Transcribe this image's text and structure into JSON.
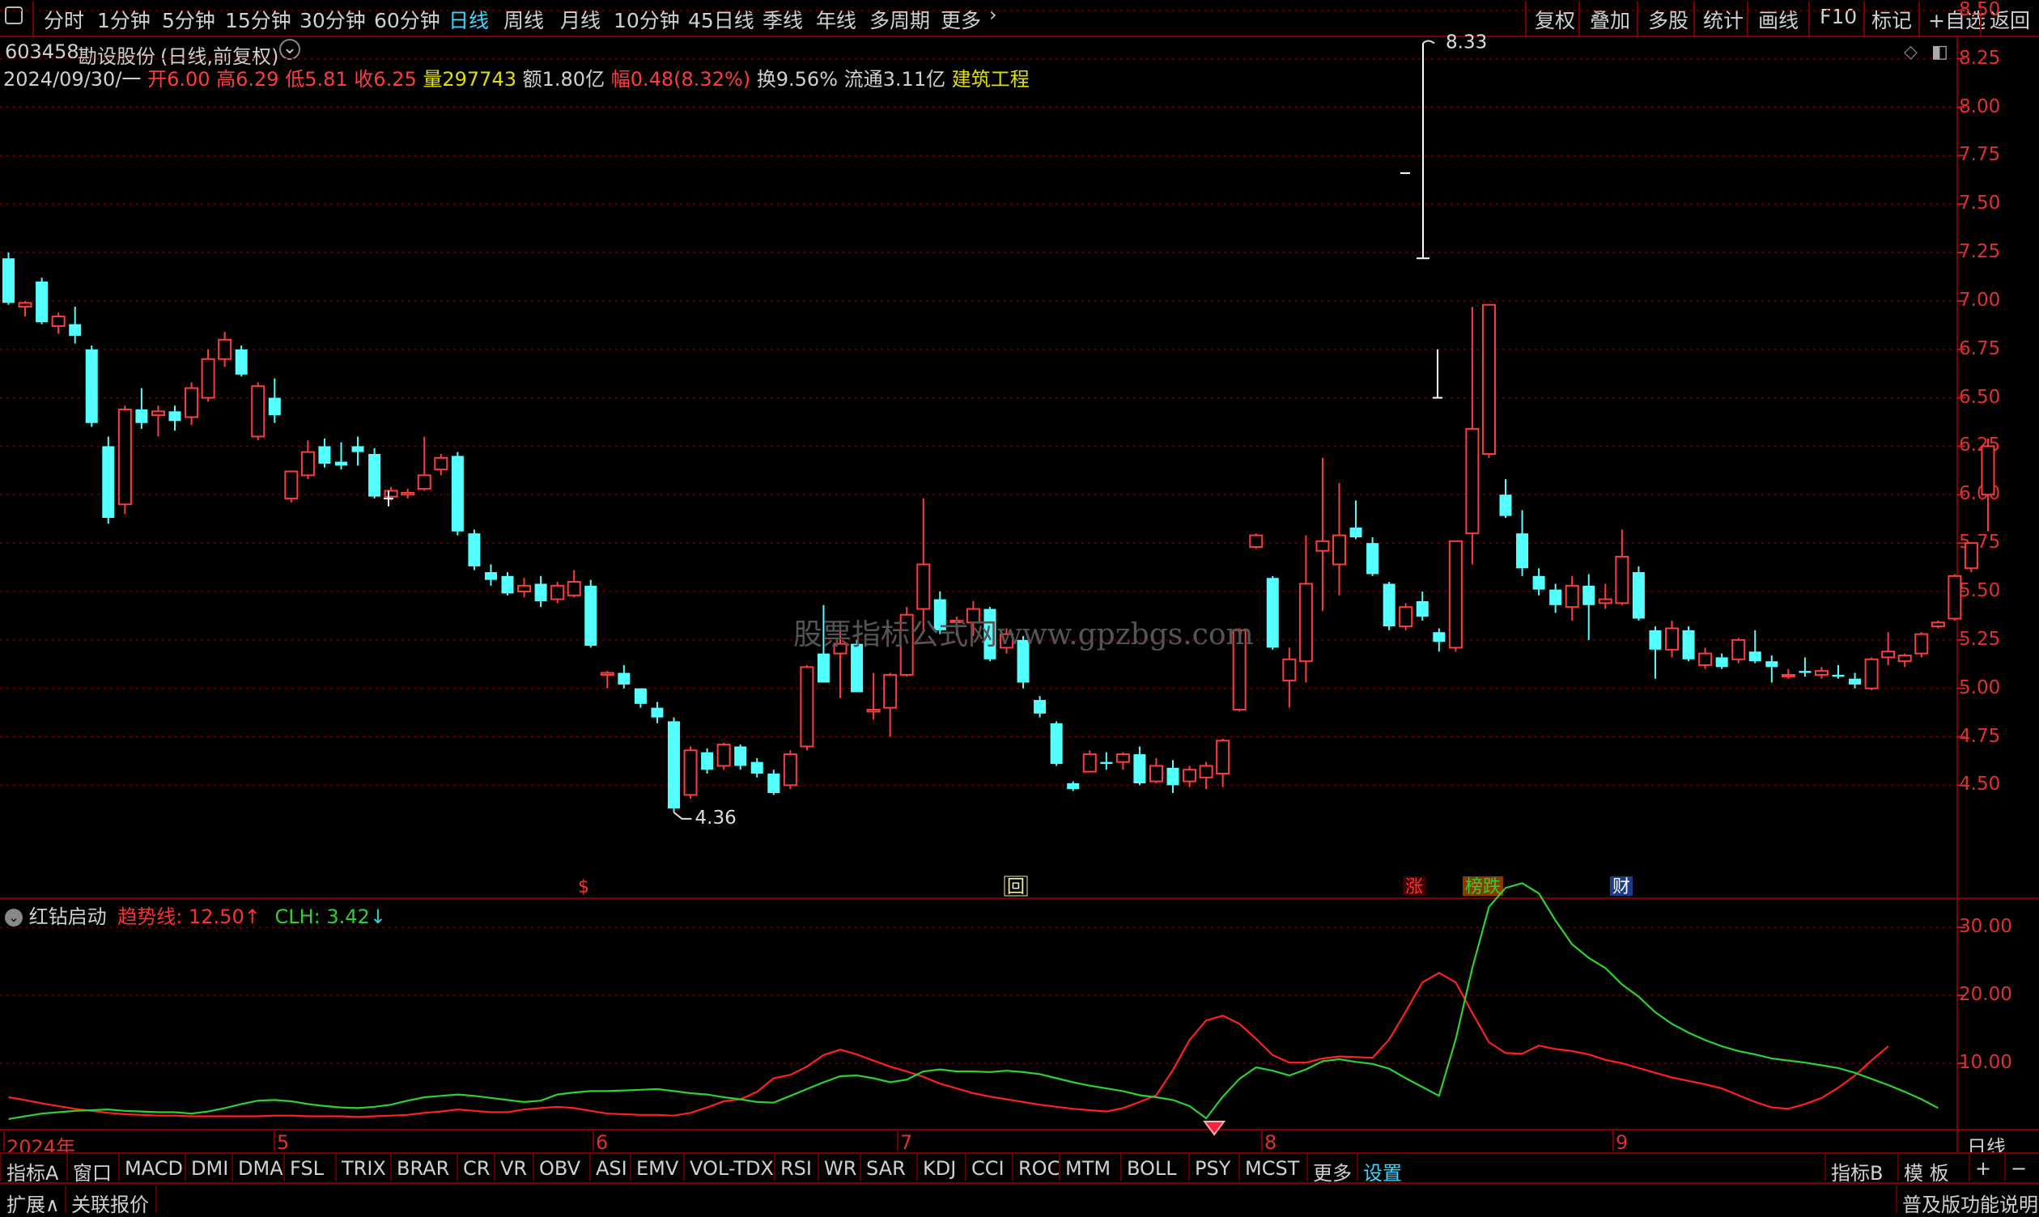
{
  "toolbar": {
    "periods": [
      "分时",
      "1分钟",
      "5分钟",
      "15分钟",
      "30分钟",
      "60分钟",
      "日线",
      "周线",
      "月线",
      "10分钟",
      "45日线",
      "季线",
      "年线",
      "多周期",
      "更多"
    ],
    "active": "日线",
    "right": [
      "复权",
      "叠加",
      "多股",
      "统计",
      "画线",
      "F10",
      "标记",
      "+自选",
      "返回"
    ]
  },
  "stock": {
    "code": "603458",
    "name": "勘设股份",
    "mode": "(日线,前复权)",
    "date": "2024/09/30/一",
    "open_label": "开",
    "open": "6.00",
    "high_label": "高",
    "high": "6.29",
    "low_label": "低",
    "low": "5.81",
    "close_label": "收",
    "close": "6.25",
    "vol_label": "量",
    "vol": "297743",
    "amt_label": "额",
    "amt": "1.80亿",
    "chg_label": "幅",
    "chg": "0.48(8.32%)",
    "turn_label": "换",
    "turn": "9.56%",
    "float_label": "流通",
    "float": "3.11亿",
    "sector": "建筑工程"
  },
  "watermark": "股票指标公式网www.gpzbgs.com",
  "price_axis": [
    "8.50",
    "8.25",
    "8.00",
    "7.75",
    "7.50",
    "7.25",
    "7.00",
    "6.75",
    "6.50",
    "6.25",
    "6.00",
    "5.75",
    "5.50",
    "5.25",
    "5.00",
    "4.75",
    "4.50"
  ],
  "annotations": {
    "high": "8.33",
    "low": "4.36"
  },
  "event_markers": [
    "$",
    "回",
    "涨",
    "榜跌",
    "财"
  ],
  "indicator": {
    "name": "红钻启动",
    "line1_label": "趋势线:",
    "line1_value": "12.50",
    "line2_label": "CLH:",
    "line2_value": "3.42",
    "axis": [
      "30.00",
      "20.00",
      "10.00"
    ]
  },
  "time_axis": {
    "labels": [
      "2024年",
      "5",
      "6",
      "7",
      "8",
      "9"
    ],
    "period": "日线"
  },
  "indicator_tabs": [
    "指标A",
    "窗口",
    "MACD",
    "DMI",
    "DMA",
    "FSL",
    "TRIX",
    "BRAR",
    "CR",
    "VR",
    "OBV",
    "ASI",
    "EMV",
    "VOL-TDX",
    "RSI",
    "WR",
    "SAR",
    "KDJ",
    "CCI",
    "ROC",
    "MTM",
    "BOLL",
    "PSY",
    "MCST",
    "更多",
    "设置"
  ],
  "indicator_right": [
    "指标B",
    "模 板",
    "+",
    "−"
  ],
  "footer": {
    "expand": "扩展∧",
    "quotes": "关联报价",
    "right": "普及版功能说明"
  },
  "colors": {
    "up": "#ff3c3c",
    "down": "#54ffff",
    "trend": "#ff2020",
    "clh": "#30d030",
    "grid": "#7a0000",
    "active": "#3ad6ff"
  },
  "chart_data": {
    "type": "candlestick",
    "ohlc": [
      [
        7.22,
        7.25,
        6.98,
        6.99
      ],
      [
        6.97,
        7.0,
        6.92,
        6.99
      ],
      [
        7.1,
        7.12,
        6.88,
        6.89
      ],
      [
        6.87,
        6.94,
        6.83,
        6.92
      ],
      [
        6.88,
        6.97,
        6.78,
        6.82
      ],
      [
        6.75,
        6.77,
        6.35,
        6.37
      ],
      [
        6.25,
        6.3,
        5.85,
        5.88
      ],
      [
        5.95,
        6.46,
        5.9,
        6.44
      ],
      [
        6.44,
        6.55,
        6.34,
        6.37
      ],
      [
        6.41,
        6.46,
        6.3,
        6.43
      ],
      [
        6.43,
        6.46,
        6.33,
        6.38
      ],
      [
        6.4,
        6.58,
        6.36,
        6.55
      ],
      [
        6.5,
        6.75,
        6.48,
        6.7
      ],
      [
        6.7,
        6.84,
        6.66,
        6.8
      ],
      [
        6.75,
        6.77,
        6.61,
        6.62
      ],
      [
        6.3,
        6.58,
        6.28,
        6.56
      ],
      [
        6.5,
        6.6,
        6.37,
        6.41
      ],
      [
        5.98,
        6.12,
        5.96,
        6.12
      ],
      [
        6.1,
        6.28,
        6.08,
        6.22
      ],
      [
        6.25,
        6.29,
        6.14,
        6.16
      ],
      [
        6.17,
        6.27,
        6.13,
        6.15
      ],
      [
        6.25,
        6.3,
        6.15,
        6.22
      ],
      [
        6.21,
        6.24,
        5.98,
        5.99
      ],
      [
        5.99,
        6.04,
        5.97,
        6.02
      ],
      [
        6.0,
        6.03,
        5.98,
        6.01
      ],
      [
        6.03,
        6.3,
        6.02,
        6.1
      ],
      [
        6.13,
        6.21,
        6.1,
        6.19
      ],
      [
        6.2,
        6.22,
        5.79,
        5.81
      ],
      [
        5.8,
        5.82,
        5.61,
        5.63
      ],
      [
        5.6,
        5.64,
        5.53,
        5.56
      ],
      [
        5.58,
        5.6,
        5.48,
        5.49
      ],
      [
        5.5,
        5.57,
        5.47,
        5.53
      ],
      [
        5.54,
        5.58,
        5.42,
        5.45
      ],
      [
        5.46,
        5.55,
        5.44,
        5.53
      ],
      [
        5.48,
        5.61,
        5.47,
        5.55
      ],
      [
        5.53,
        5.56,
        5.21,
        5.22
      ],
      [
        5.07,
        5.09,
        5.0,
        5.08
      ],
      [
        5.08,
        5.12,
        5.0,
        5.02
      ],
      [
        5.0,
        5.0,
        4.9,
        4.92
      ],
      [
        4.9,
        4.93,
        4.82,
        4.85
      ],
      [
        4.83,
        4.85,
        4.36,
        4.38
      ],
      [
        4.45,
        4.7,
        4.43,
        4.68
      ],
      [
        4.67,
        4.69,
        4.56,
        4.58
      ],
      [
        4.6,
        4.72,
        4.58,
        4.71
      ],
      [
        4.7,
        4.71,
        4.58,
        4.6
      ],
      [
        4.62,
        4.64,
        4.54,
        4.56
      ],
      [
        4.56,
        4.58,
        4.45,
        4.46
      ],
      [
        4.5,
        4.68,
        4.48,
        4.66
      ],
      [
        4.7,
        5.12,
        4.68,
        5.11
      ],
      [
        5.18,
        5.43,
        5.03,
        5.03
      ],
      [
        5.18,
        5.35,
        4.95,
        5.23
      ],
      [
        5.23,
        5.25,
        4.98,
        4.98
      ],
      [
        4.88,
        5.08,
        4.84,
        4.89
      ],
      [
        4.9,
        5.08,
        4.75,
        5.07
      ],
      [
        5.07,
        5.42,
        5.06,
        5.38
      ],
      [
        5.41,
        5.98,
        5.3,
        5.64
      ],
      [
        5.46,
        5.5,
        5.28,
        5.3
      ],
      [
        5.35,
        5.37,
        5.27,
        5.35
      ],
      [
        5.34,
        5.45,
        5.27,
        5.41
      ],
      [
        5.41,
        5.42,
        5.14,
        5.15
      ],
      [
        5.21,
        5.31,
        5.18,
        5.28
      ],
      [
        5.25,
        5.27,
        5.0,
        5.03
      ],
      [
        4.94,
        4.96,
        4.85,
        4.87
      ],
      [
        4.82,
        4.83,
        4.6,
        4.61
      ],
      [
        4.51,
        4.52,
        4.47,
        4.48
      ],
      [
        4.57,
        4.68,
        4.57,
        4.66
      ],
      [
        4.62,
        4.67,
        4.58,
        4.61
      ],
      [
        4.62,
        4.67,
        4.58,
        4.66
      ],
      [
        4.66,
        4.7,
        4.5,
        4.51
      ],
      [
        4.52,
        4.64,
        4.51,
        4.6
      ],
      [
        4.59,
        4.63,
        4.46,
        4.5
      ],
      [
        4.52,
        4.6,
        4.49,
        4.58
      ],
      [
        4.54,
        4.62,
        4.48,
        4.6
      ],
      [
        4.56,
        4.74,
        4.49,
        4.73
      ],
      [
        4.89,
        5.31,
        4.88,
        5.3
      ],
      [
        5.73,
        5.8,
        5.72,
        5.79
      ],
      [
        5.57,
        5.58,
        5.2,
        5.21
      ],
      [
        5.04,
        5.21,
        4.9,
        5.15
      ],
      [
        5.14,
        5.79,
        5.03,
        5.54
      ],
      [
        5.71,
        6.19,
        5.4,
        5.76
      ],
      [
        5.64,
        6.06,
        5.48,
        5.79
      ],
      [
        5.83,
        5.97,
        5.77,
        5.78
      ],
      [
        5.75,
        5.78,
        5.58,
        5.59
      ],
      [
        5.54,
        5.55,
        5.3,
        5.32
      ],
      [
        5.32,
        5.44,
        5.3,
        5.42
      ],
      [
        5.45,
        5.5,
        5.35,
        5.37
      ],
      [
        5.29,
        5.31,
        5.19,
        5.24
      ],
      [
        5.21,
        5.76,
        5.19,
        5.76
      ],
      [
        5.8,
        6.97,
        5.64,
        6.34
      ],
      [
        6.21,
        6.98,
        6.19,
        6.98
      ],
      [
        6.0,
        6.08,
        5.88,
        5.89
      ],
      [
        5.8,
        5.92,
        5.58,
        5.62
      ],
      [
        5.58,
        5.62,
        5.48,
        5.51
      ],
      [
        5.51,
        5.54,
        5.39,
        5.43
      ],
      [
        5.42,
        5.58,
        5.35,
        5.53
      ],
      [
        5.53,
        5.59,
        5.25,
        5.43
      ],
      [
        5.44,
        5.54,
        5.41,
        5.46
      ],
      [
        5.44,
        5.82,
        5.43,
        5.68
      ],
      [
        5.6,
        5.63,
        5.35,
        5.36
      ],
      [
        5.3,
        5.32,
        5.05,
        5.2
      ],
      [
        5.2,
        5.35,
        5.16,
        5.31
      ],
      [
        5.3,
        5.32,
        5.14,
        5.15
      ],
      [
        5.12,
        5.21,
        5.1,
        5.18
      ],
      [
        5.16,
        5.18,
        5.1,
        5.11
      ],
      [
        5.15,
        5.26,
        5.13,
        5.25
      ],
      [
        5.19,
        5.3,
        5.13,
        5.14
      ],
      [
        5.14,
        5.17,
        5.03,
        5.11
      ],
      [
        5.07,
        5.1,
        5.05,
        5.07
      ],
      [
        5.09,
        5.16,
        5.06,
        5.08
      ],
      [
        5.07,
        5.11,
        5.05,
        5.09
      ],
      [
        5.07,
        5.12,
        5.05,
        5.06
      ],
      [
        5.05,
        5.08,
        5.0,
        5.02
      ],
      [
        5.0,
        5.16,
        4.99,
        5.15
      ],
      [
        5.16,
        5.29,
        5.12,
        5.19
      ],
      [
        5.14,
        5.18,
        5.11,
        5.17
      ],
      [
        5.18,
        5.29,
        5.16,
        5.28
      ],
      [
        5.32,
        5.35,
        5.31,
        5.34
      ],
      [
        5.36,
        5.59,
        5.35,
        5.58
      ],
      [
        5.62,
        5.75,
        5.6,
        5.75
      ],
      [
        6.0,
        6.29,
        5.81,
        6.25
      ]
    ],
    "sim_bar": [
      7.22,
      8.33,
      6.68
    ],
    "x_labels": [
      "2024年",
      "5",
      "6",
      "7",
      "8",
      "9"
    ],
    "y_range": [
      4.3,
      8.6
    ],
    "indicator_series": [
      {
        "name": "趋势线",
        "values": [
          5.0,
          4.6,
          4.1,
          3.7,
          3.3,
          3.0,
          2.7,
          2.5,
          2.4,
          2.3,
          2.3,
          2.2,
          2.2,
          2.2,
          2.2,
          2.2,
          2.3,
          2.3,
          2.2,
          2.2,
          2.2,
          2.1,
          2.2,
          2.3,
          2.4,
          2.7,
          2.9,
          3.2,
          3.0,
          2.8,
          2.8,
          3.2,
          3.4,
          3.6,
          3.4,
          3.0,
          2.6,
          2.5,
          2.4,
          2.4,
          2.3,
          2.7,
          3.5,
          4.4,
          4.7,
          5.8,
          7.8,
          8.3,
          9.5,
          11.2,
          12.0,
          11.3,
          10.4,
          9.5,
          8.8,
          8.0,
          7.0,
          6.3,
          5.6,
          5.1,
          4.7,
          4.3,
          3.9,
          3.6,
          3.3,
          3.1,
          2.9,
          3.4,
          4.3,
          5.3,
          9.0,
          13.4,
          16.3,
          17.0,
          15.8,
          13.6,
          11.2,
          10.1,
          10.1,
          10.7,
          11.0,
          10.9,
          10.8,
          13.5,
          17.6,
          21.9,
          23.3,
          21.9,
          17.4,
          13.1,
          11.5,
          11.4,
          12.6,
          12.1,
          11.8,
          11.3,
          10.5,
          10.0,
          9.3,
          8.6,
          7.9,
          7.4,
          6.9,
          6.3,
          5.3,
          4.3,
          3.5,
          3.3,
          4.0,
          4.9,
          6.4,
          8.2,
          10.4,
          12.5
        ]
      },
      {
        "name": "CLH",
        "values": [
          1.8,
          2.2,
          2.6,
          2.8,
          3.0,
          3.1,
          3.2,
          3.0,
          2.9,
          2.8,
          2.8,
          2.6,
          2.9,
          3.4,
          4.0,
          4.5,
          4.6,
          4.4,
          4.0,
          3.7,
          3.5,
          3.4,
          3.6,
          3.9,
          4.5,
          5.0,
          5.2,
          5.4,
          5.2,
          4.9,
          4.6,
          4.3,
          4.5,
          5.4,
          5.7,
          5.9,
          5.9,
          6.0,
          6.1,
          6.2,
          5.9,
          5.6,
          5.4,
          5.0,
          4.7,
          4.3,
          4.2,
          5.2,
          6.2,
          7.2,
          8.1,
          8.2,
          7.8,
          7.2,
          7.6,
          8.8,
          9.1,
          8.8,
          8.8,
          8.7,
          8.9,
          8.7,
          8.4,
          7.8,
          7.2,
          6.7,
          6.3,
          5.9,
          5.3,
          5.0,
          4.6,
          3.7,
          1.9,
          5.1,
          7.7,
          9.4,
          8.9,
          8.2,
          9.1,
          10.3,
          10.6,
          10.2,
          9.9,
          9.2,
          7.8,
          6.5,
          5.2,
          13.5,
          24.0,
          33.0,
          35.8,
          36.5,
          35.0,
          31.0,
          27.5,
          25.5,
          24.0,
          21.6,
          19.8,
          17.5,
          15.8,
          14.5,
          13.4,
          12.5,
          11.8,
          11.3,
          10.7,
          10.4,
          10.1,
          9.7,
          9.3,
          8.6,
          7.7,
          6.8,
          5.8,
          4.7,
          3.42
        ]
      }
    ],
    "indicator_ylim": [
      0,
      40
    ],
    "signal_marker_index": 72
  }
}
